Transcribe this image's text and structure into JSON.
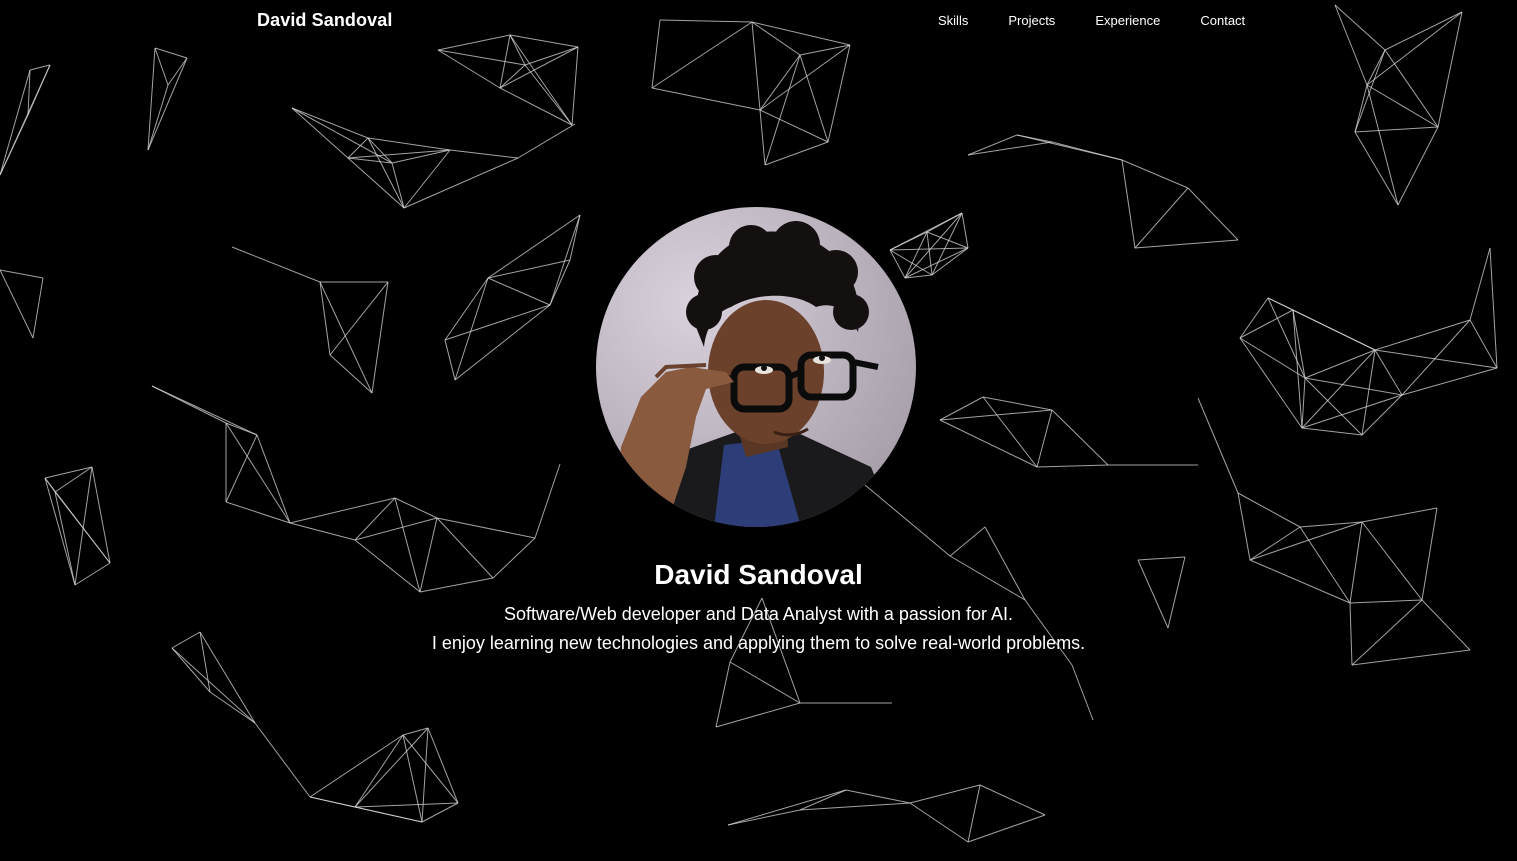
{
  "header": {
    "brand": "David Sandoval",
    "nav": [
      {
        "label": "Skills"
      },
      {
        "label": "Projects"
      },
      {
        "label": "Experience"
      },
      {
        "label": "Contact"
      }
    ]
  },
  "hero": {
    "name": "David Sandoval",
    "tagline": "Software/Web developer and Data Analyst with a passion for AI.",
    "description": "I enjoy learning new technologies and applying them to solve real-world problems."
  },
  "colors": {
    "background": "#000000",
    "text": "#ffffff",
    "network_lines": "#d8d8d8"
  }
}
